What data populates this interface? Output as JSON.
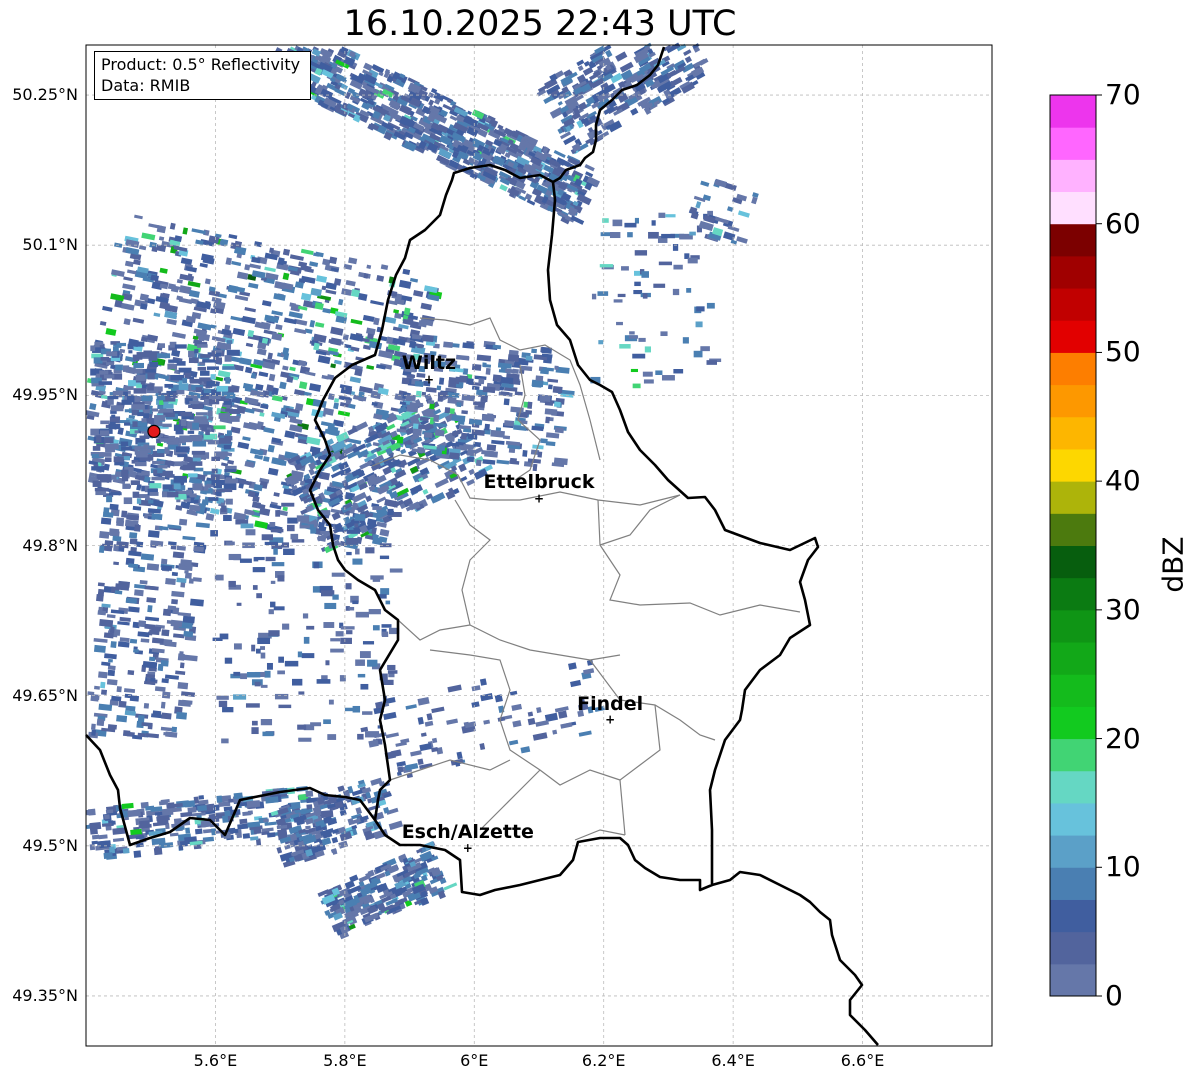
{
  "title": "16.10.2025 22:43 UTC",
  "info_box": {
    "product": "Product: 0.5° Reflectivity",
    "data": "Data: RMIB"
  },
  "axes": {
    "lat_labels": [
      "50.25°N",
      "50.1°N",
      "49.95°N",
      "49.8°N",
      "49.65°N",
      "49.5°N",
      "49.35°N"
    ],
    "lon_labels": [
      "5.6°E",
      "5.8°E",
      "6°E",
      "6.2°E",
      "6.4°E",
      "6.6°E"
    ],
    "lat_values": [
      50.25,
      50.1,
      49.95,
      49.8,
      49.65,
      49.5,
      49.35
    ],
    "lon_values": [
      5.6,
      5.8,
      6.0,
      6.2,
      6.4,
      6.6
    ],
    "lon_range": [
      5.4,
      6.8
    ],
    "lat_range": [
      49.3,
      50.3
    ],
    "grid": true
  },
  "cities": [
    {
      "name": "Wiltz",
      "lon": 5.93,
      "lat": 49.966
    },
    {
      "name": "Ettelbruck",
      "lon": 6.1,
      "lat": 49.847
    },
    {
      "name": "Findel",
      "lon": 6.21,
      "lat": 49.626
    },
    {
      "name": "Esch/Alzette",
      "lon": 5.99,
      "lat": 49.498
    }
  ],
  "radar_site": {
    "lon": 5.505,
    "lat": 49.914,
    "color": "#e31a1c"
  },
  "colorbar": {
    "label": "dBZ",
    "min": 0,
    "max": 70,
    "tick_labels": [
      "0",
      "10",
      "20",
      "30",
      "40",
      "50",
      "60",
      "70"
    ],
    "ticks": [
      0,
      10,
      20,
      30,
      40,
      50,
      60,
      70
    ],
    "colors": [
      "#6577a9",
      "#52649d",
      "#405e9f",
      "#4a7fb2",
      "#5ba0c8",
      "#67c2dc",
      "#65d7c3",
      "#41d474",
      "#12ca1f",
      "#14bb1c",
      "#12a818",
      "#0f9515",
      "#0b7b12",
      "#075e0e",
      "#4c7a0e",
      "#adb40a",
      "#fdd700",
      "#fdb600",
      "#fd9800",
      "#fd7e00",
      "#e20000",
      "#c10000",
      "#a00000",
      "#7c0000",
      "#ffdfff",
      "#ffb2ff",
      "#ff66ff",
      "#ed35ed"
    ]
  },
  "colors": {
    "border": "#000000",
    "canton_border": "#808080",
    "grid": "#bbbbbb"
  }
}
